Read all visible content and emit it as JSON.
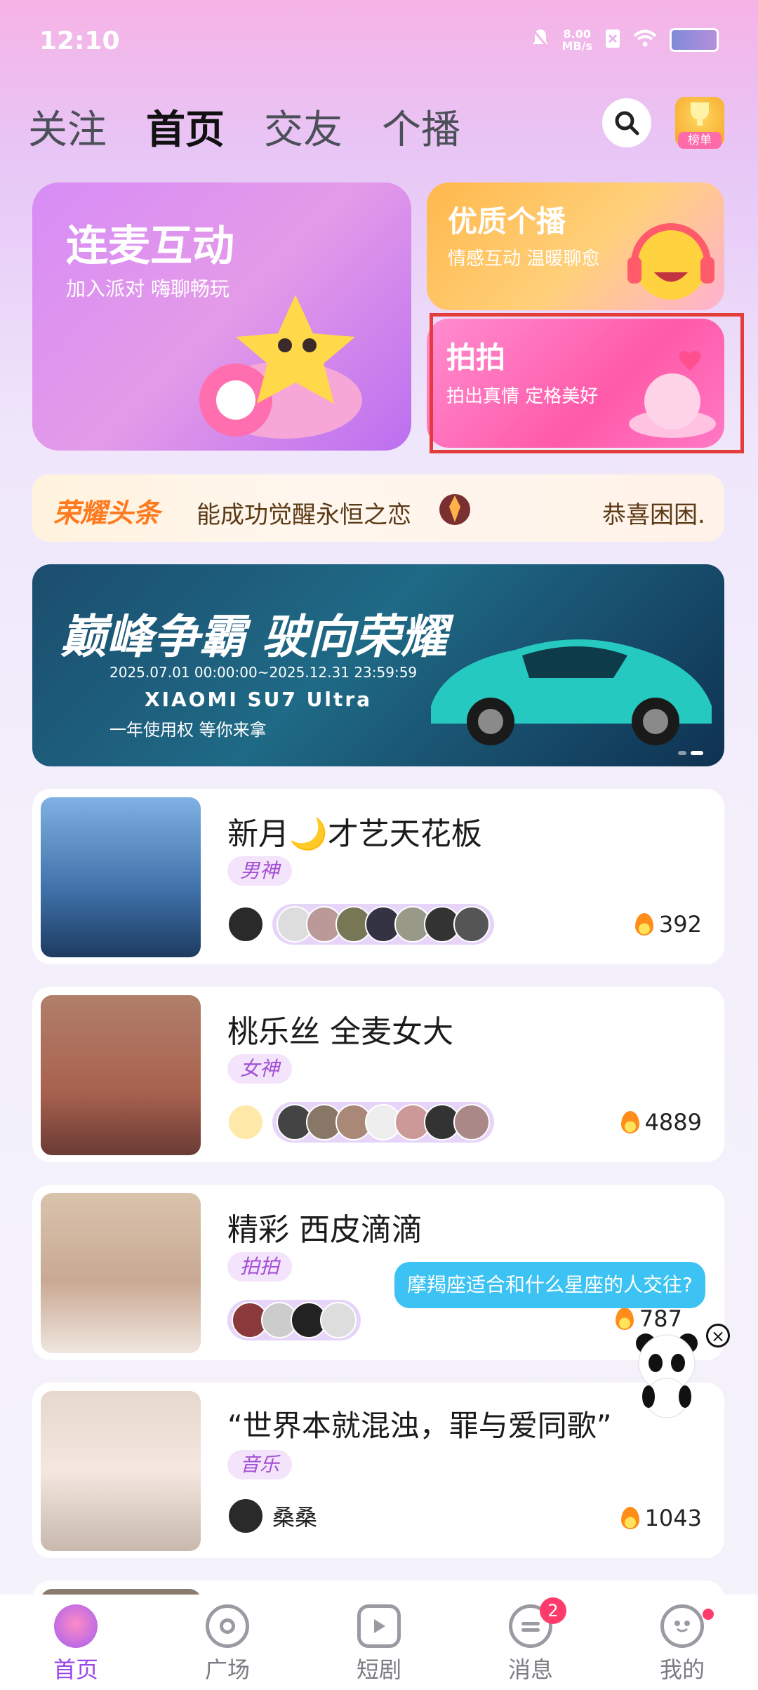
{
  "status_bar": {
    "time": "12:10",
    "speed_value": "8.00",
    "speed_unit": "MB/s"
  },
  "top_nav": {
    "tabs": [
      {
        "label": "关注"
      },
      {
        "label": "首页"
      },
      {
        "label": "交友"
      },
      {
        "label": "个播"
      }
    ],
    "active_tab": "首页",
    "rank_label": "榜单"
  },
  "features": {
    "big": {
      "title": "连麦互动",
      "subtitle": "加入派对 嗨聊畅玩"
    },
    "top_right": {
      "title": "优质个播",
      "subtitle": "情感互动 温暖聊愈"
    },
    "bottom_right": {
      "title": "拍拍",
      "subtitle": "拍出真情 定格美好"
    }
  },
  "ticker": {
    "label": "荣耀头条",
    "text_a": "能成功觉醒永恒之恋",
    "text_b": "恭喜困困."
  },
  "banner": {
    "headline": "巅峰争霸 驶向荣耀",
    "dates": "2025.07.01 00:00:00~2025.12.31 23:59:59",
    "brand": "XIAOMI SU7 Ultra",
    "prize": "一年使用权 等你来拿"
  },
  "rooms": [
    {
      "title": "新月🌙才艺天花板",
      "tag": "男神",
      "heat": "392"
    },
    {
      "title": "桃乐丝 全麦女大",
      "tag": "女神",
      "heat": "4889"
    },
    {
      "title": "精彩 西皮滴滴",
      "tag": "拍拍",
      "heat": "787"
    },
    {
      "title": "“世界本就混浊，罪与爱同歌”",
      "tag": "音乐",
      "heat": "1043",
      "host_name": "桑桑"
    }
  ],
  "assistant": {
    "question": "摩羯座适合和什么星座的人交往?"
  },
  "bottom_nav": {
    "items": [
      {
        "label": "首页"
      },
      {
        "label": "广场"
      },
      {
        "label": "短剧"
      },
      {
        "label": "消息"
      },
      {
        "label": "我的"
      }
    ],
    "messages_badge": "2"
  }
}
